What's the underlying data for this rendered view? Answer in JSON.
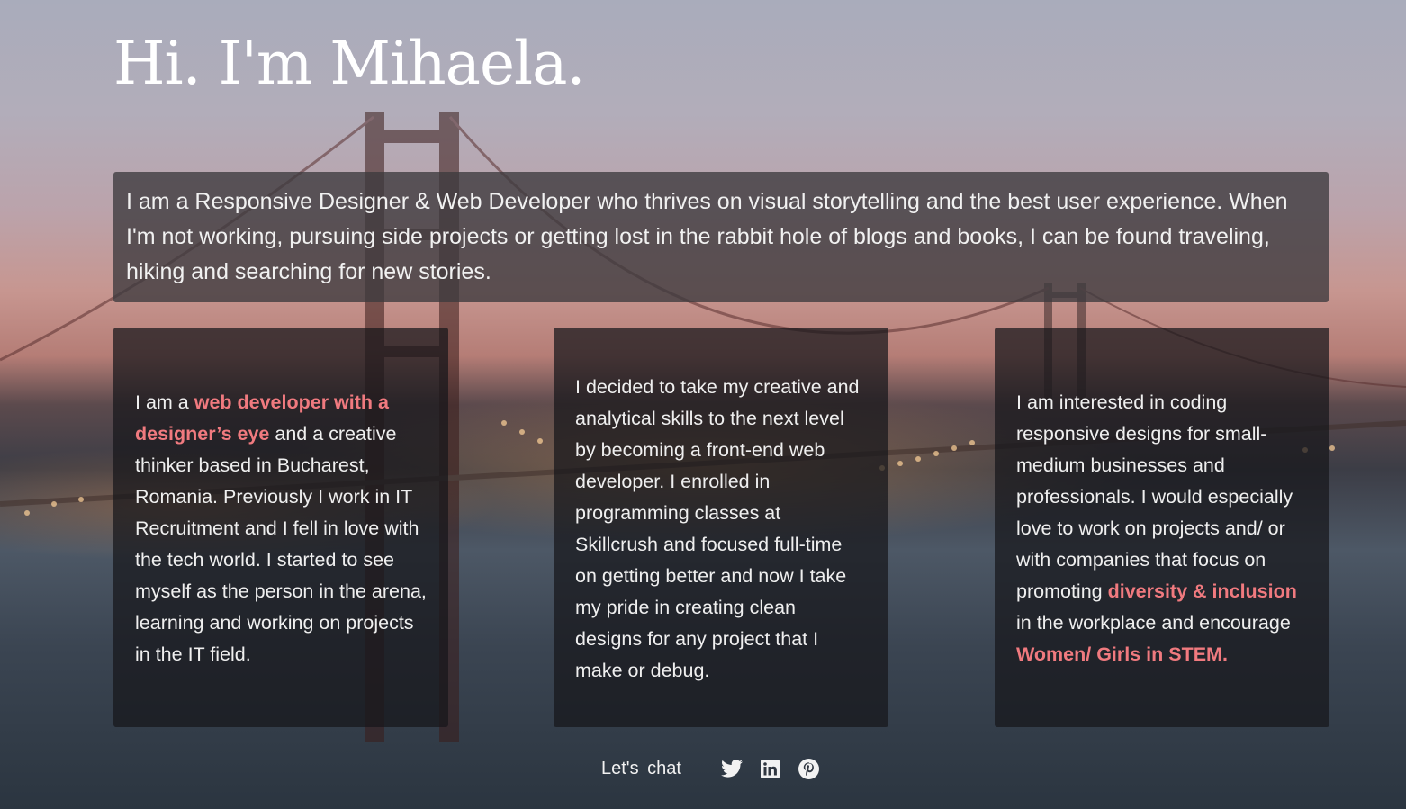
{
  "header": {
    "title": "Hi. I'm Mihaela."
  },
  "intro": {
    "text": "I am a Responsive Designer & Web Developer who thrives on visual storytelling and the best user experience. When I'm not working, pursuing side projects or getting lost in the rabbit hole of blogs and books, I can be found traveling, hiking and searching for new stories."
  },
  "cards": [
    {
      "pre": "I am a ",
      "highlight": "web developer with a designer’s eye",
      "post": " and a creative thinker based in Bucharest, Romania. Previously I work in IT Recruitment and I fell in love with the tech world. I started to see myself as the person in the arena, learning and working on projects in the IT field."
    },
    {
      "text": "I decided to take my creative and analytical skills to the next level by becoming a front-end web developer. I enrolled in programming classes at Skillcrush and focused full-time on getting better and now I take my pride in creating clean designs for any project that I make or debug."
    },
    {
      "pre": "I am interested in coding responsive designs for small-medium businesses and professionals. I would especially love to work on projects and/ or with companies that focus on promoting ",
      "highlight1": "diversity & inclusion",
      "mid": " in the workplace and encourage ",
      "highlight2": "Women/ Girls in STEM."
    }
  ],
  "footer": {
    "label": "Let's  chat",
    "icons": [
      "twitter-icon",
      "linkedin-icon",
      "pinterest-icon"
    ]
  },
  "colors": {
    "accent": "#f07a7f",
    "text": "#f2f2f2"
  }
}
